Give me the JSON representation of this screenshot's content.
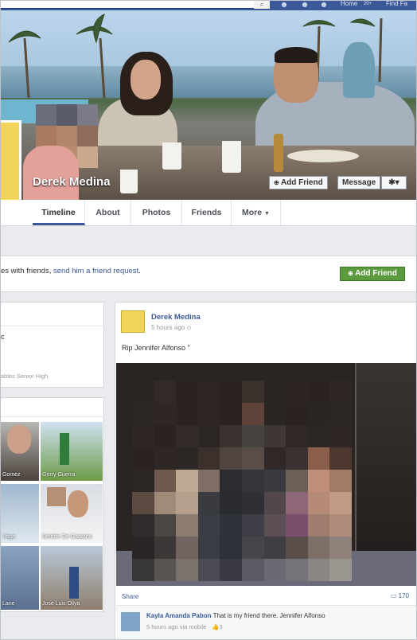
{
  "topbar": {
    "nav": [
      "Home",
      "20+",
      "Find Fa"
    ],
    "search_icon": "magnifier-icon"
  },
  "profile": {
    "name": "Derek Medina",
    "add_friend_label": "Add Friend",
    "message_label": "Message",
    "settings_label": "▾"
  },
  "tabs": [
    "Timeline",
    "About",
    "Photos",
    "Friends",
    "More"
  ],
  "friend_request": {
    "prefix": "es with friends, ",
    "link": "send him a friend request",
    "suffix": ".",
    "button": "Add Friend"
  },
  "left": {
    "education_text": "ables Senior High",
    "intro_fragment": "c",
    "photos": [
      {
        "caption": "Gomez"
      },
      {
        "caption": "Gerry Guerra"
      },
      {
        "caption": "Vega"
      },
      {
        "caption": "Deirdre De Gaetano"
      },
      {
        "caption": "Lane"
      },
      {
        "caption": "Jose Luis Oliya"
      }
    ]
  },
  "post": {
    "author": "Derek Medina",
    "time": "5 hours ago",
    "text": "Rip Jennifer Alfonso \"",
    "share_label": "Share",
    "comment_count": "170",
    "comment": {
      "author": "Kayla Amanda Pabon",
      "text": "That is my friend there. Jennifer Alfonso",
      "meta": "5 hours ago via mobile · ",
      "likes": "3"
    }
  },
  "colors": {
    "brand": "#3b5998",
    "add_friend_green": "#5b9b3d"
  }
}
